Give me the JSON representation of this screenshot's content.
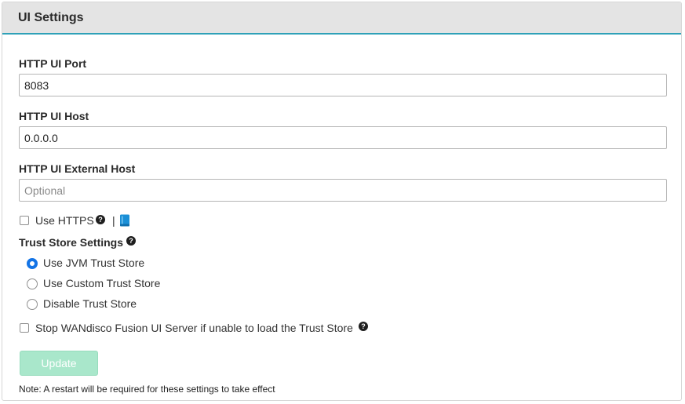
{
  "panel": {
    "title": "UI Settings"
  },
  "fields": {
    "port": {
      "label": "HTTP UI Port",
      "value": "8083",
      "placeholder": ""
    },
    "host": {
      "label": "HTTP UI Host",
      "value": "0.0.0.0",
      "placeholder": ""
    },
    "external_host": {
      "label": "HTTP UI External Host",
      "value": "",
      "placeholder": "Optional"
    }
  },
  "https": {
    "label": "Use HTTPS",
    "checked": false,
    "help_icon": "question-circle",
    "separator": "|",
    "docs_icon": "book"
  },
  "trust_store": {
    "title": "Trust Store Settings",
    "help_icon": "question-circle",
    "options": [
      {
        "label": "Use JVM Trust Store",
        "selected": true
      },
      {
        "label": "Use Custom Trust Store",
        "selected": false
      },
      {
        "label": "Disable Trust Store",
        "selected": false
      }
    ]
  },
  "stop_server": {
    "label": "Stop WANdisco Fusion UI Server if unable to load the Trust Store",
    "checked": false,
    "help_icon": "question-circle"
  },
  "actions": {
    "update_label": "Update",
    "update_enabled": false
  },
  "note": "Note: A restart will be required for these settings to take effect",
  "colors": {
    "header_accent": "#2ea1b8",
    "radio_selected": "#1474e6",
    "update_button_disabled": "#a9e7cb",
    "book_icon": "#1a8fd6"
  }
}
